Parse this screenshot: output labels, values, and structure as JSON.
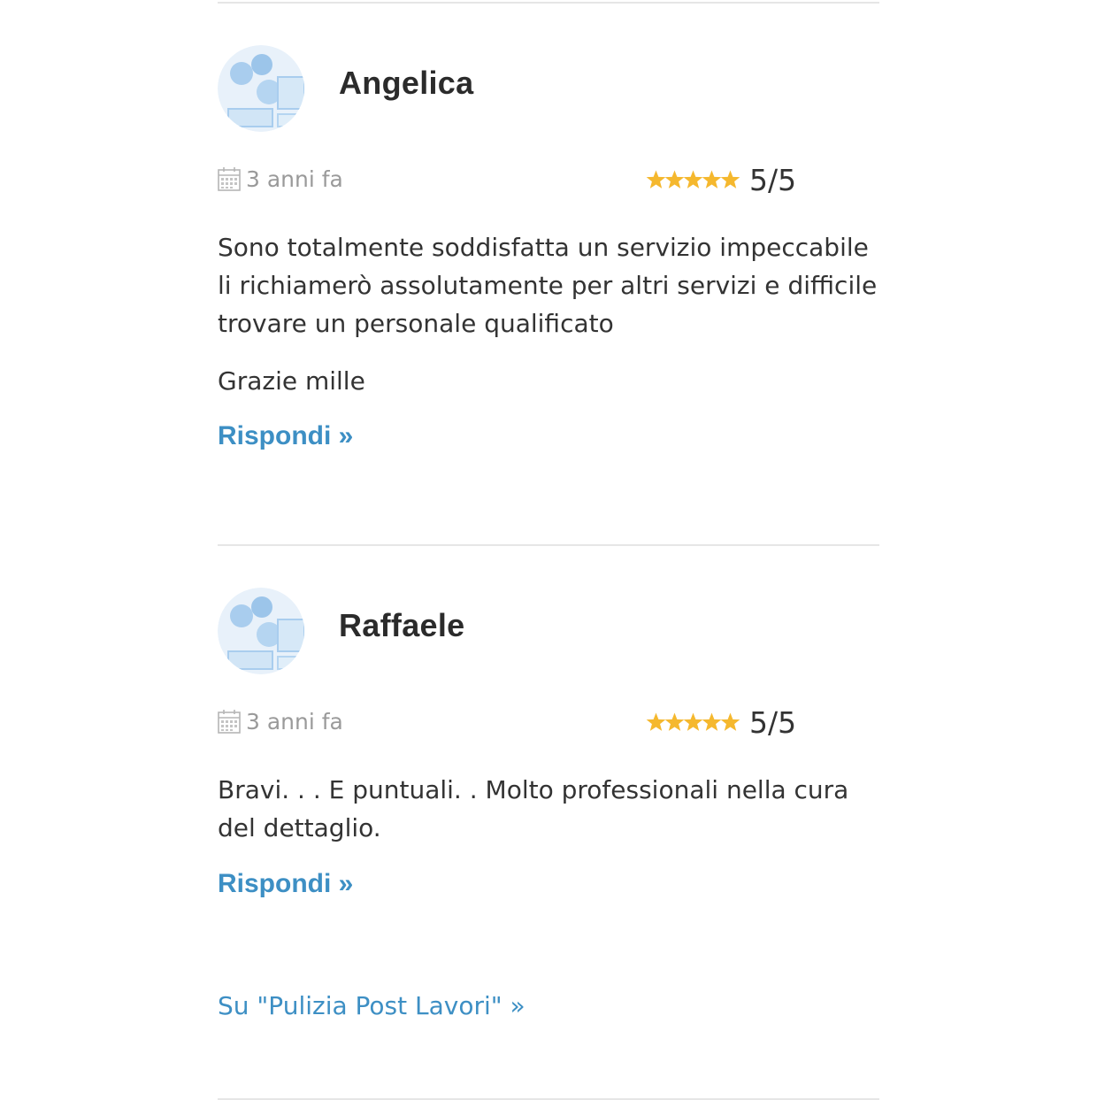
{
  "reviews": [
    {
      "author": "Angelica",
      "date": "3 anni fa",
      "rating": 5,
      "rating_max": 5,
      "rating_text": "5/5",
      "paragraphs": [
        "Sono totalmente soddisfatta un servizio impeccabile li richiamerò assolutamente per altri servizi e difficile trovare un personale qualificato",
        "Grazie mille"
      ],
      "reply_label": "Rispondi »"
    },
    {
      "author": "Raffaele",
      "date": "3 anni fa",
      "rating": 5,
      "rating_max": 5,
      "rating_text": "5/5",
      "paragraphs": [
        "Bravi. . . E puntuali. . Molto professionali nella cura del dettaglio."
      ],
      "reply_label": "Rispondi »"
    }
  ],
  "footer": {
    "link_label": "Su \"Pulizia Post Lavori\"  »"
  },
  "colors": {
    "accent_link": "#3d8fc4",
    "star": "#f5b82e",
    "divider": "#e6e6e6",
    "muted_text": "#9a9a9a"
  },
  "icons": {
    "avatar": "default-avatar-icon",
    "calendar": "calendar-icon",
    "star": "star-icon"
  }
}
